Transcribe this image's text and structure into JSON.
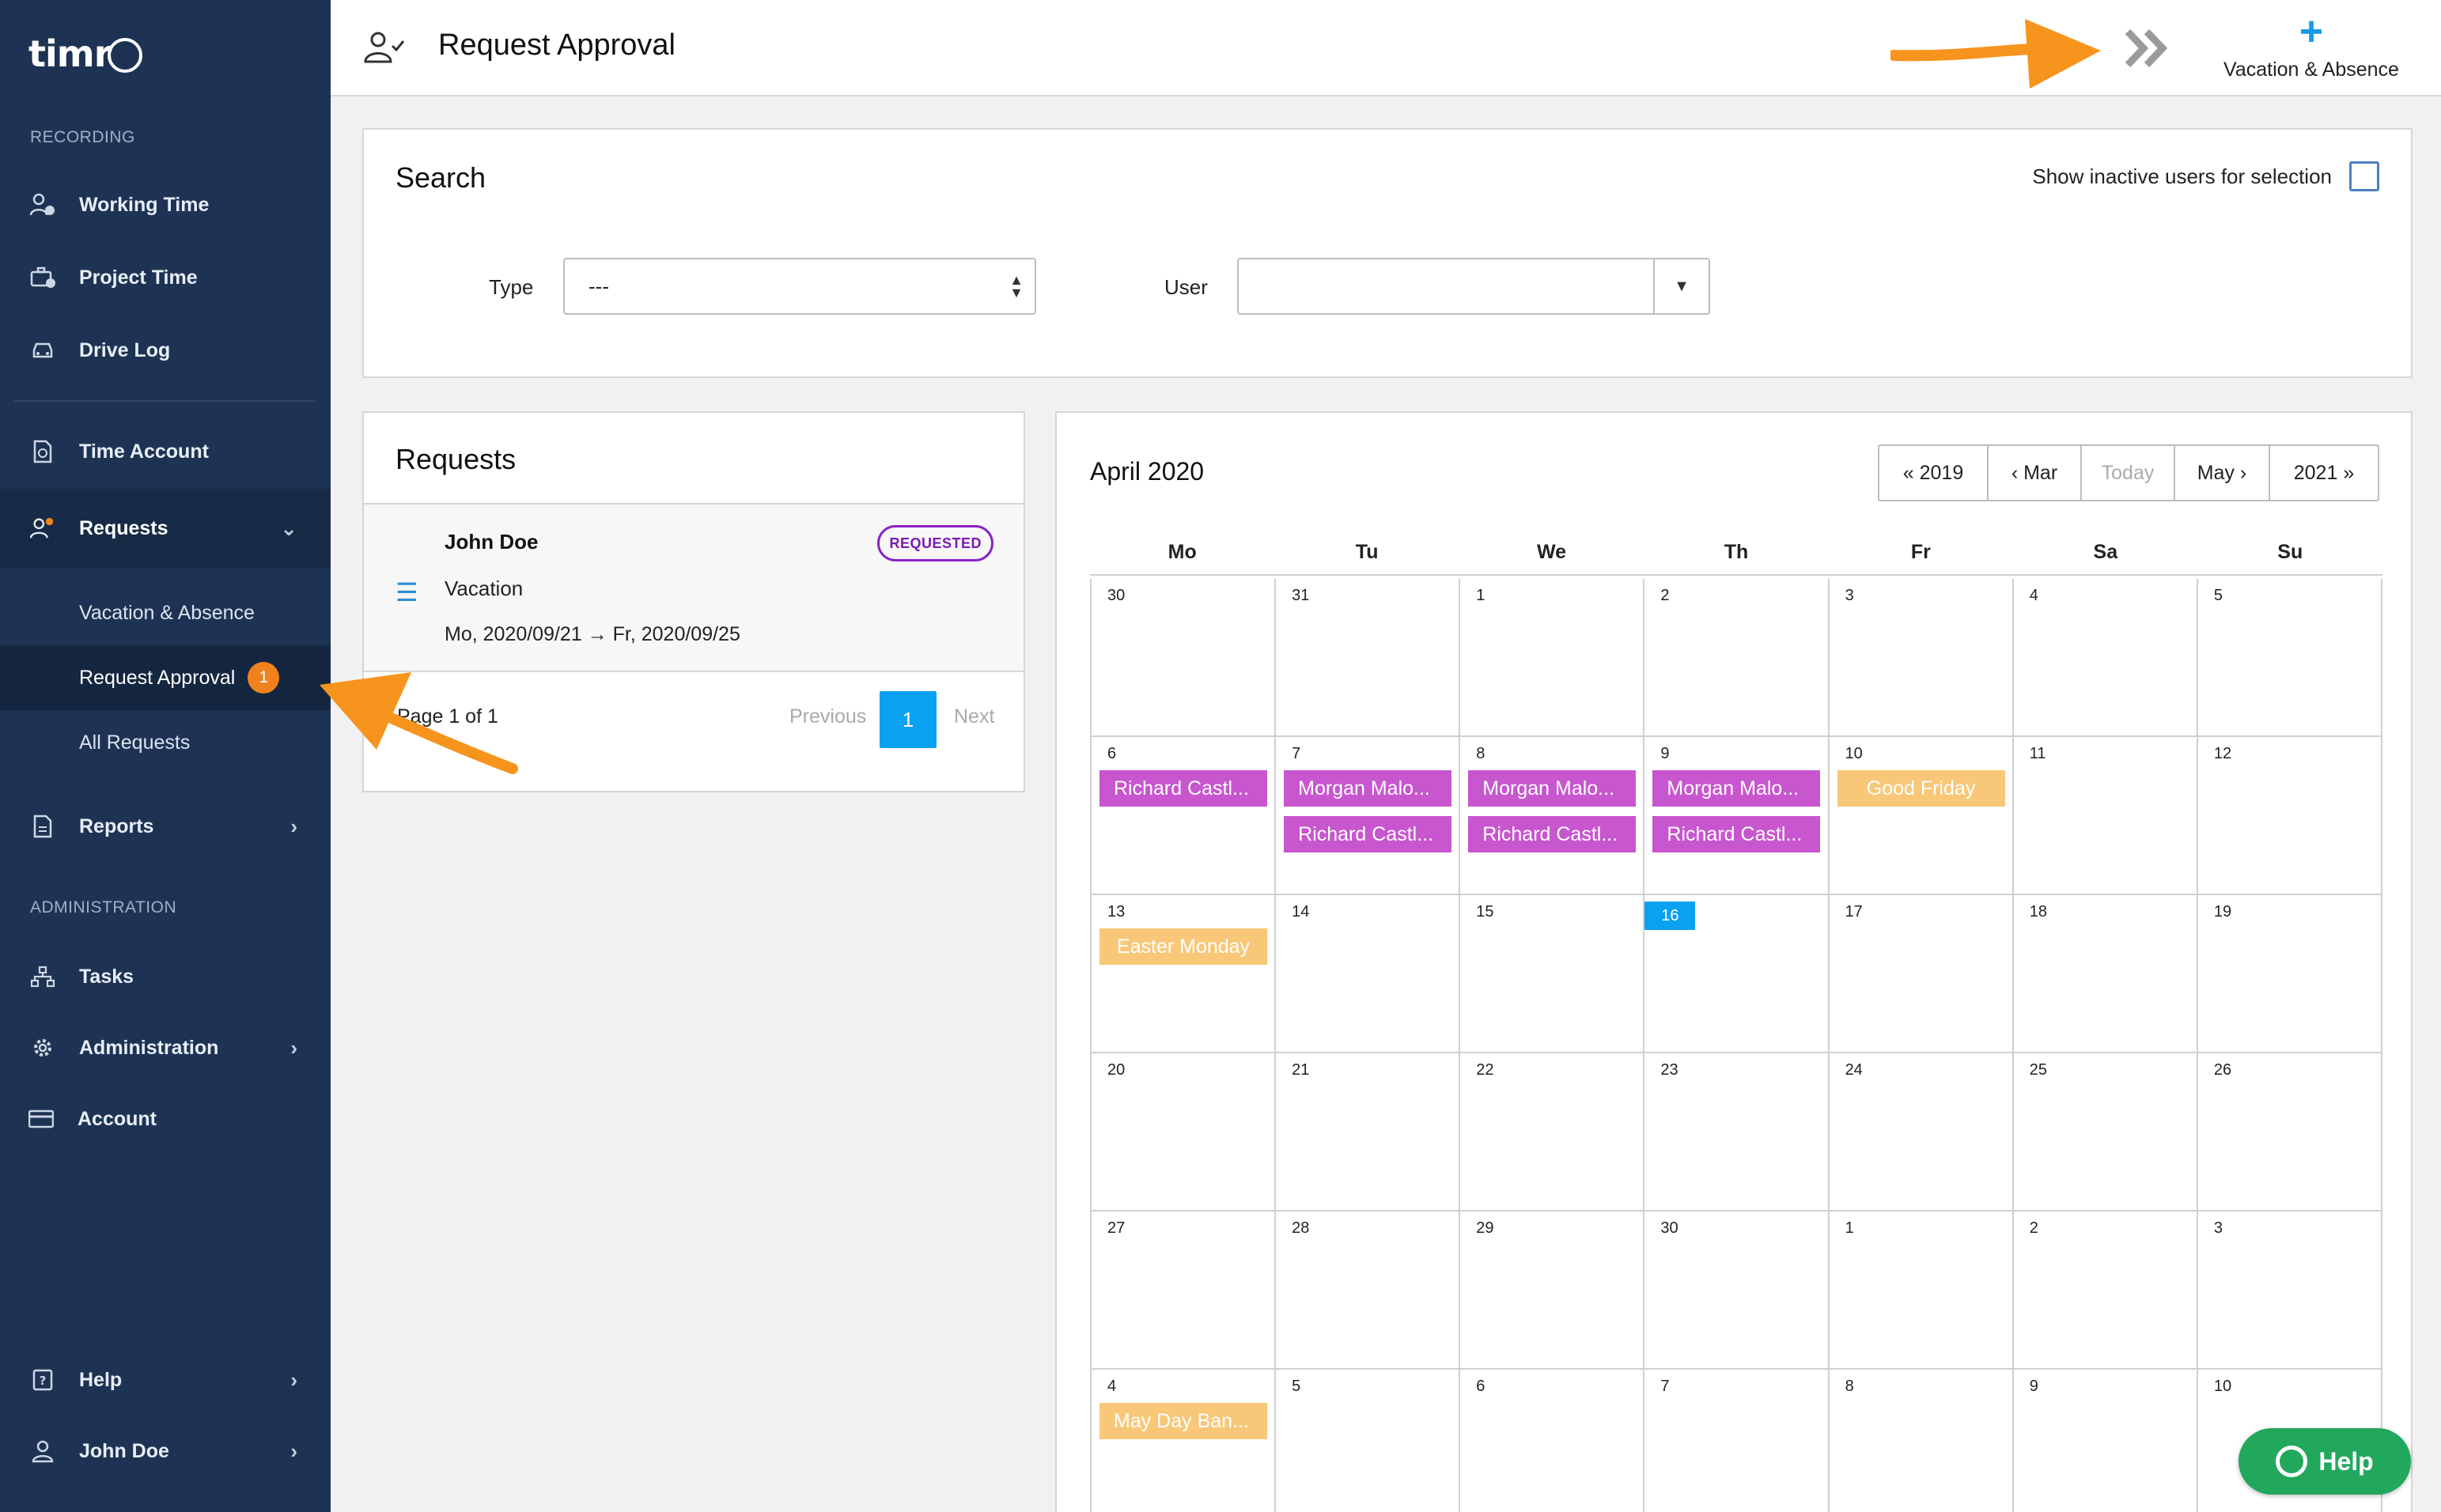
{
  "app": {
    "logo": "timr"
  },
  "sidebar": {
    "sections": {
      "recording": "RECORDING",
      "administration": "ADMINISTRATION"
    },
    "items": {
      "working_time": "Working Time",
      "project_time": "Project Time",
      "drive_log": "Drive Log",
      "time_account": "Time Account",
      "requests": "Requests",
      "reports": "Reports",
      "tasks": "Tasks",
      "administration": "Administration",
      "account": "Account",
      "help": "Help",
      "user": "John Doe"
    },
    "requests_sub": {
      "vacation": "Vacation & Absence",
      "approval": "Request Approval",
      "approval_badge": "1",
      "all": "All Requests"
    }
  },
  "header": {
    "title": "Request Approval",
    "next_icon": "double-chevron-right-icon",
    "add_label": "Vacation & Absence",
    "add_icon": "+"
  },
  "search": {
    "title": "Search",
    "inactive_label": "Show inactive users for selection",
    "inactive_checked": false,
    "type_label": "Type",
    "type_value": "---",
    "user_label": "User",
    "user_value": ""
  },
  "requests": {
    "title": "Requests",
    "item": {
      "name": "John Doe",
      "type": "Vacation",
      "dates": "Mo, 2020/09/21 → Fr, 2020/09/25",
      "status": "REQUESTED"
    },
    "pager": {
      "text": "Page 1 of 1",
      "previous": "Previous",
      "current": "1",
      "next": "Next"
    }
  },
  "calendar": {
    "title": "April 2020",
    "nav": {
      "prev_year": "2019",
      "prev_month": "Mar",
      "today": "Today",
      "next_month": "May",
      "next_year": "2021"
    },
    "dows": [
      "Mo",
      "Tu",
      "We",
      "Th",
      "Fr",
      "Sa",
      "Su"
    ],
    "weeks": [
      [
        "30",
        "31",
        "1",
        "2",
        "3",
        "4",
        "5"
      ],
      [
        "6",
        "7",
        "8",
        "9",
        "10",
        "11",
        "12"
      ],
      [
        "13",
        "14",
        "15",
        "16",
        "17",
        "18",
        "19"
      ],
      [
        "20",
        "21",
        "22",
        "23",
        "24",
        "25",
        "26"
      ],
      [
        "27",
        "28",
        "29",
        "30",
        "1",
        "2",
        "3"
      ],
      [
        "4",
        "5",
        "6",
        "7",
        "8",
        "9",
        "10"
      ]
    ],
    "events": {
      "w1_mo": "Richard Castl...",
      "w1_tu_1": "Morgan Malo...",
      "w1_tu_2": "Richard Castl...",
      "w1_we_1": "Morgan Malo...",
      "w1_we_2": "Richard Castl...",
      "w1_th_1": "Morgan Malo...",
      "w1_th_2": "Richard Castl...",
      "w1_fr": "Good Friday",
      "w2_mo": "Easter Monday",
      "w5_mo": "May Day Ban..."
    },
    "colors": {
      "person": "#c856cf",
      "holiday": "#f8c778",
      "today": "#0aa1f0"
    }
  },
  "help_widget": {
    "label": "Help",
    "color": "#22a85c"
  },
  "colors": {
    "sidebar": "#1e3354",
    "accent": "#0aa1f0",
    "badge": "#f0821e",
    "annotation_arrow": "#f7941d"
  }
}
